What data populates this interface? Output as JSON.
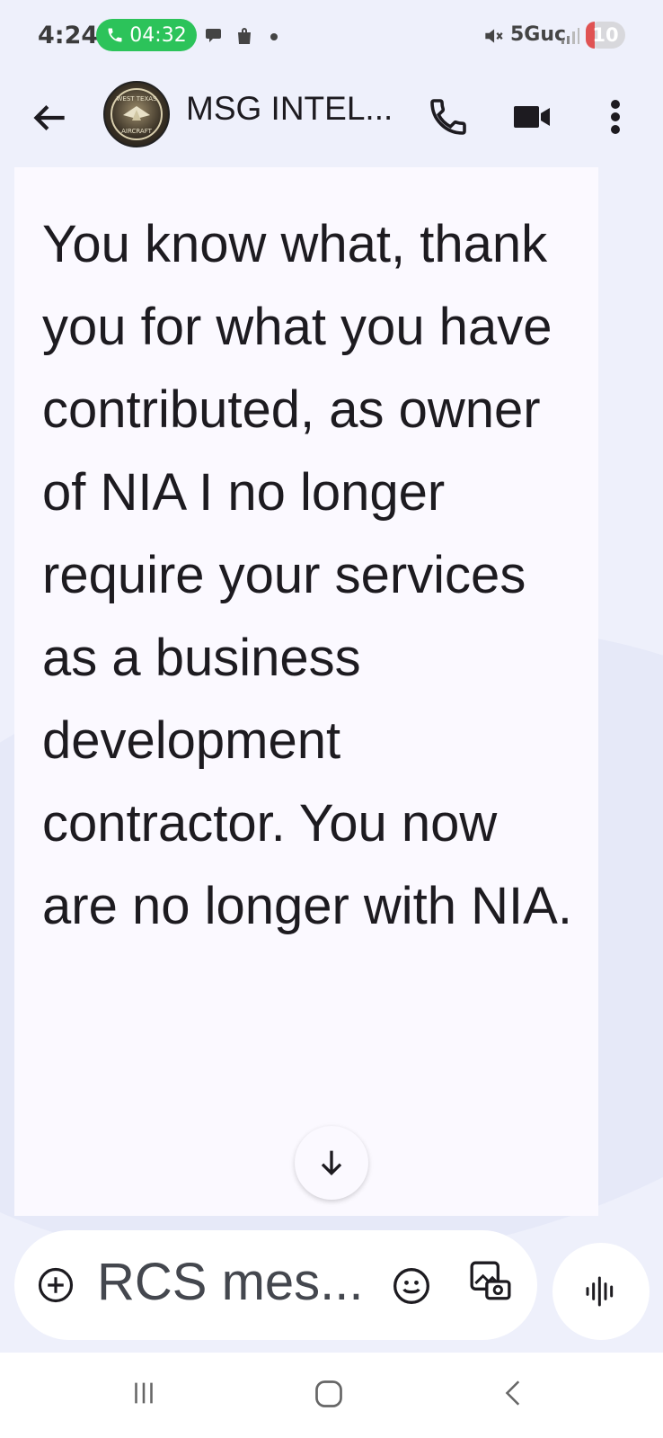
{
  "status_bar": {
    "time": "4:24",
    "call_timer": "04:32",
    "network": "5Guc",
    "battery": "10"
  },
  "app_bar": {
    "title": "MSG INTEL...",
    "avatar_text": "WEST TEXAS AIRCRAFT"
  },
  "message": {
    "text": "You know what, thank you for what you have contributed, as owner of NIA I no longer require your services as a business development contractor. You now are no longer with NIA."
  },
  "composer": {
    "placeholder": "RCS mes..."
  },
  "colors": {
    "call_pill": "#2cc35a",
    "battery_low": "#e05353",
    "bubble_bg": "#fbf9ff",
    "app_bg": "#eef0fb"
  }
}
